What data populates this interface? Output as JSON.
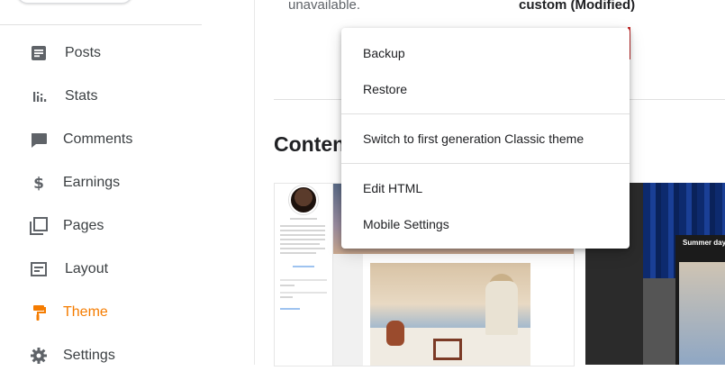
{
  "sidebar": {
    "items": [
      {
        "label": "Posts",
        "icon": "posts-icon",
        "active": false
      },
      {
        "label": "Stats",
        "icon": "stats-icon",
        "active": false
      },
      {
        "label": "Comments",
        "icon": "comments-icon",
        "active": false
      },
      {
        "label": "Earnings",
        "icon": "dollar-icon",
        "active": false
      },
      {
        "label": "Pages",
        "icon": "pages-icon",
        "active": false
      },
      {
        "label": "Layout",
        "icon": "layout-icon",
        "active": false
      },
      {
        "label": "Theme",
        "icon": "paint-roller-icon",
        "active": true
      },
      {
        "label": "Settings",
        "icon": "gear-icon",
        "active": false
      }
    ]
  },
  "main": {
    "unavailable_text": "unavailable.",
    "theme_status": "custom (Modified)",
    "content_heading": "Conten",
    "preview_dark_title": "Summer days in"
  },
  "menu": {
    "items": [
      {
        "label": "Backup"
      },
      {
        "label": "Restore"
      },
      {
        "label": "Switch to first generation Classic theme"
      },
      {
        "label": "Edit HTML"
      },
      {
        "label": "Mobile Settings"
      }
    ]
  },
  "colors": {
    "accent": "#f57c00",
    "icon_gray": "#5f6368"
  }
}
